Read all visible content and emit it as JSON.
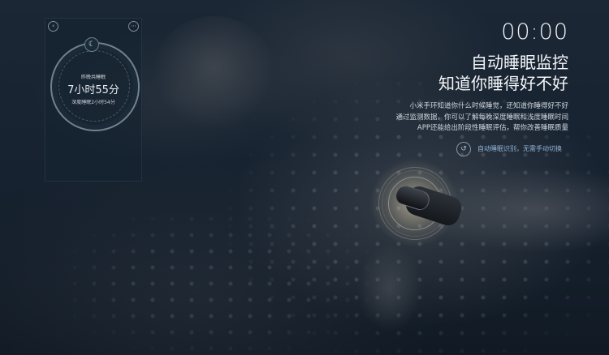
{
  "phone": {
    "back_icon": "back-arrow-icon",
    "more_icon": "more-icon",
    "moon_icon": "moon-icon",
    "label": "昨晚共睡眠",
    "total": "7小时55分",
    "deep": "深度睡眠2小时54分"
  },
  "hero": {
    "clock": "00:00",
    "title_line1": "自动睡眠监控",
    "title_line2": "知道你睡得好不好",
    "paragraph": [
      "小米手环知道你什么时候睡觉，还知道你睡得好不好",
      "通过监测数据，你可以了解每晚深度睡眠和浅度睡眠时间",
      "APP还能给出阶段性睡眠评估，帮你改善睡眠质量"
    ],
    "feature_icon": "hand-gesture-icon",
    "feature_text": "自动睡眠识别，无需手动切换"
  },
  "colors": {
    "background": "#172230",
    "accent_text": "#8fb3d6",
    "heading": "#f4f6f8"
  }
}
